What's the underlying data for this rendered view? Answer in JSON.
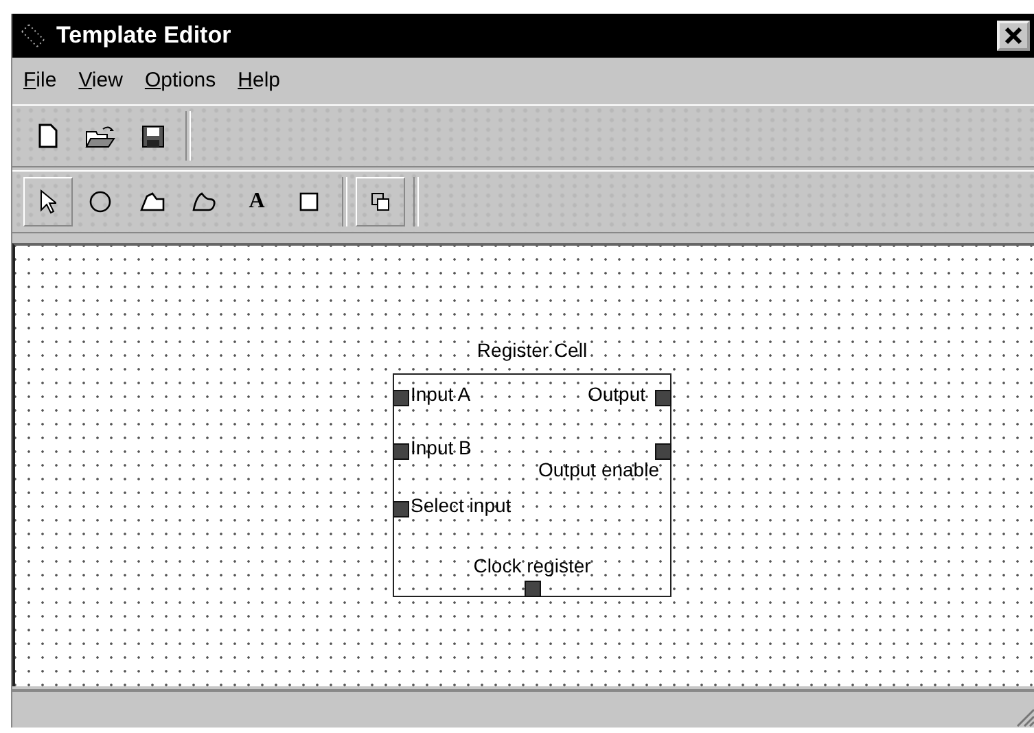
{
  "window": {
    "title": "Template Editor"
  },
  "menu": [
    {
      "label": "File"
    },
    {
      "label": "View"
    },
    {
      "label": "Options"
    },
    {
      "label": "Help"
    }
  ],
  "file_toolbar": [
    {
      "kind": "new"
    },
    {
      "kind": "open"
    },
    {
      "kind": "save"
    }
  ],
  "tool_toolbar": [
    {
      "kind": "pointer",
      "selected": true
    },
    {
      "kind": "ellipse",
      "selected": false
    },
    {
      "kind": "polygon",
      "selected": false
    },
    {
      "kind": "freeform",
      "selected": false
    },
    {
      "kind": "text",
      "label": "A",
      "selected": false
    },
    {
      "kind": "rectangle",
      "selected": false
    }
  ],
  "arrange_toolbar": [
    {
      "kind": "overlap",
      "selected": true
    }
  ],
  "block": {
    "title": "Register Cell",
    "ports": [
      {
        "label": "Input A",
        "kind": "input"
      },
      {
        "label": "Output",
        "kind": "output"
      },
      {
        "label": "Input B",
        "kind": "input"
      },
      {
        "label": "Output enable",
        "kind": "output"
      },
      {
        "label": "Select input",
        "kind": "input"
      },
      {
        "label": "Clock register",
        "kind": "clock"
      }
    ]
  }
}
